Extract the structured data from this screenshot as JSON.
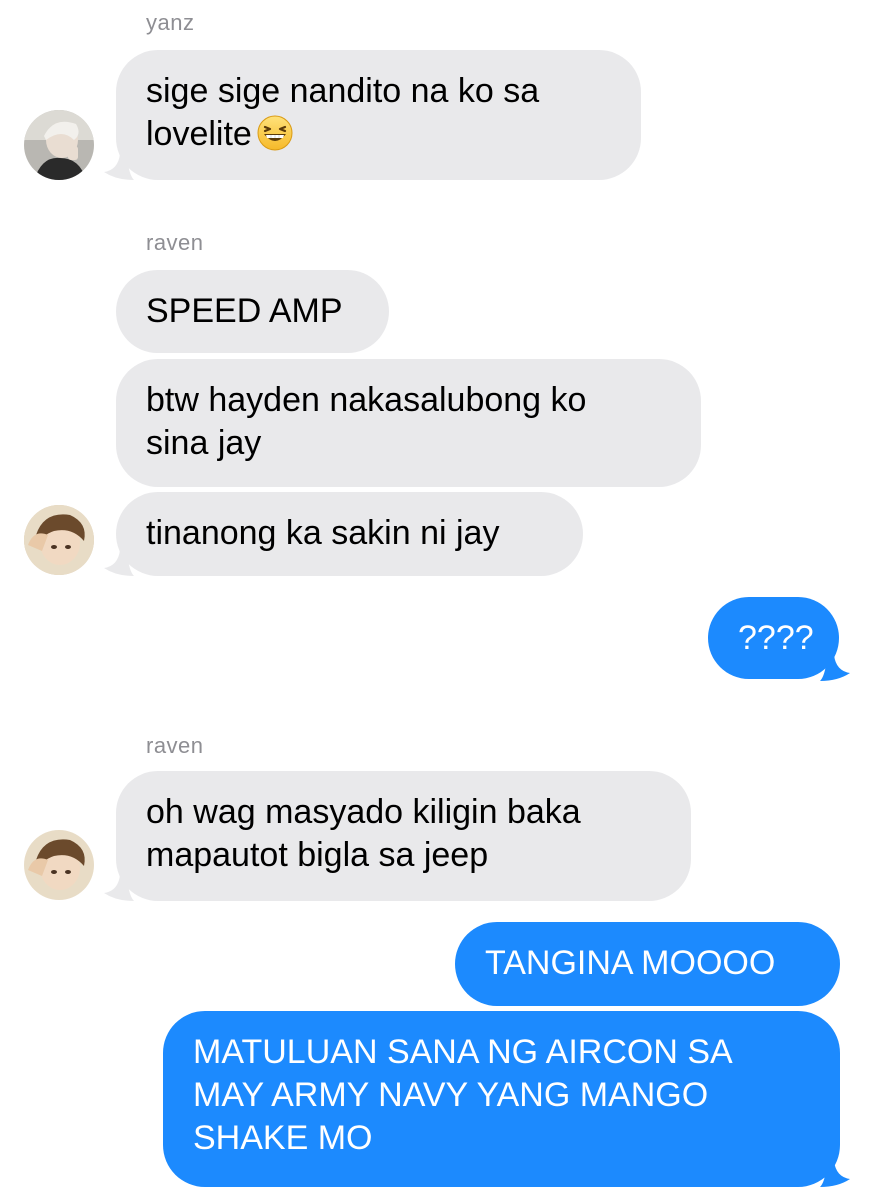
{
  "messages": [
    {
      "sender": "yanz",
      "lines": [
        "sige sige nandito na ko sa",
        "lovelite"
      ],
      "emoji": "grinning-squinting-face-emoji"
    },
    {
      "sender": "raven",
      "text": "SPEED AMP"
    },
    {
      "lines": [
        "btw hayden nakasalubong ko",
        "sina jay"
      ]
    },
    {
      "text": "tinanong ka sakin ni jay"
    },
    {
      "text": "????",
      "direction": "outgoing"
    },
    {
      "sender": "raven",
      "lines": [
        "oh wag masyado kiligin baka",
        "mapautot bigla sa jeep"
      ]
    },
    {
      "text": "TANGINA MOOOO",
      "direction": "outgoing"
    },
    {
      "lines": [
        "MATULUAN SANA NG AIRCON SA",
        "MAY ARMY NAVY YANG MANGO",
        "SHAKE MO"
      ],
      "direction": "outgoing"
    }
  ],
  "colors": {
    "incoming_bubble": "#e9e9eb",
    "outgoing_bubble": "#1c8afe",
    "sender_label": "#8e8e93"
  },
  "avatars": [
    "yanz-avatar",
    "raven-avatar",
    "raven-avatar"
  ]
}
